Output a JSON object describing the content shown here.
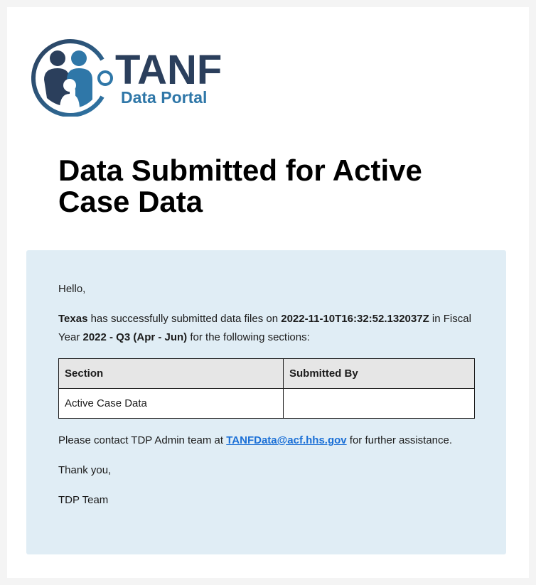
{
  "logo": {
    "title": "TANF",
    "subtitle": "Data Portal",
    "colors": {
      "dark": "#2b3f5c",
      "accent": "#2f77a8"
    }
  },
  "page_title": "Data Submitted for Active Case Data",
  "message": {
    "greeting": "Hello,",
    "summary": {
      "stt": "Texas",
      "text1": " has successfully submitted data files on ",
      "timestamp": "2022-11-10T16:32:52.132037Z",
      "text2": " in Fiscal Year ",
      "fiscal_period": "2022 - Q3 (Apr - Jun)",
      "text3": " for the following sections:"
    },
    "table": {
      "headers": [
        "Section",
        "Submitted By"
      ],
      "rows": [
        [
          "Active Case Data",
          ""
        ]
      ]
    },
    "contact": {
      "before": "Please contact TDP Admin team at ",
      "email": "TANFData@acf.hhs.gov",
      "after": " for further assistance."
    },
    "closing": "Thank you,",
    "signature": "TDP Team"
  },
  "colors": {
    "message_background": "#e0edf5",
    "link": "#1a6fd6"
  }
}
